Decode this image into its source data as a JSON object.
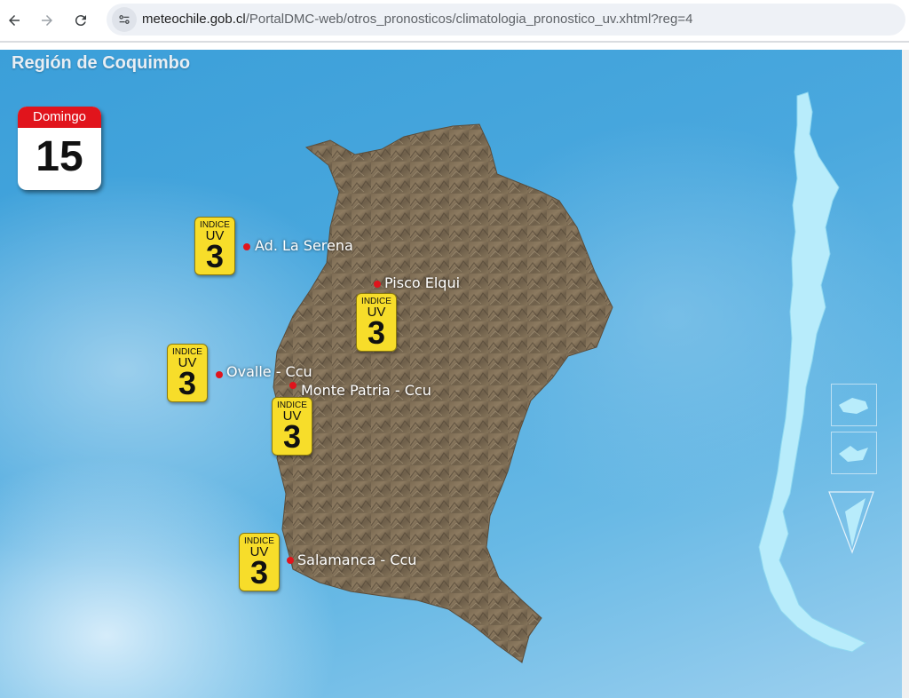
{
  "browser": {
    "url_host": "meteochile.gob.cl",
    "url_path": "/PortalDMC-web/otros_pronosticos/climatologia_pronostico_uv.xhtml?reg=4",
    "icons": {
      "back": "arrow-left-icon",
      "forward": "arrow-right-icon",
      "reload": "reload-icon",
      "site": "site-settings-icon"
    }
  },
  "page": {
    "region_title": "Región de Coquimbo",
    "calendar": {
      "weekday": "Domingo",
      "day": "15"
    },
    "uv_badge": {
      "line1": "INDICE",
      "line2": "UV"
    },
    "stations": [
      {
        "name": "Ad. La Serena",
        "uv": "3"
      },
      {
        "name": "Pisco Elqui",
        "uv": "3"
      },
      {
        "name": "Ovalle - Ccu",
        "uv": "3"
      },
      {
        "name": "Monte Patria - Ccu",
        "uv": "3"
      },
      {
        "name": "Salamanca - Ccu",
        "uv": "3"
      }
    ],
    "colors": {
      "uv_badge": "#f7dd2a",
      "marker": "#e0141c",
      "calendar_header": "#e1141c",
      "chile_map": "#b8ecfb"
    }
  }
}
